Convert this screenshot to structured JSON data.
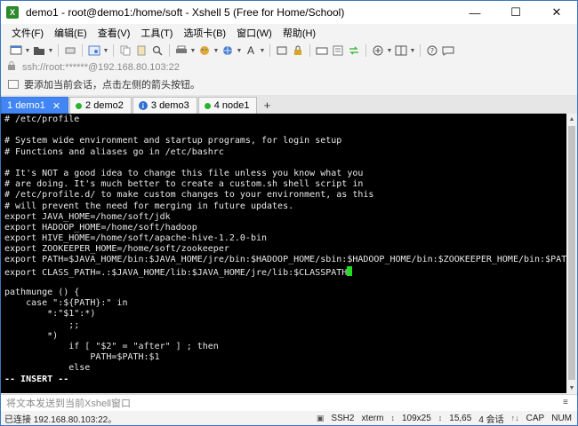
{
  "window": {
    "title": "demo1 - root@demo1:/home/soft - Xshell 5 (Free for Home/School)",
    "controls": {
      "minimize": "—",
      "maximize": "☐",
      "close": "✕"
    }
  },
  "menu": [
    {
      "label": "文件(F)"
    },
    {
      "label": "编辑(E)"
    },
    {
      "label": "查看(V)"
    },
    {
      "label": "工具(T)"
    },
    {
      "label": "选项卡(B)"
    },
    {
      "label": "窗口(W)"
    },
    {
      "label": "帮助(H)"
    }
  ],
  "address": {
    "text": "ssh://root:******@192.168.80.103:22"
  },
  "hint": {
    "text": "要添加当前会话，点击左侧的箭头按钮。"
  },
  "tabs": [
    {
      "num": "1",
      "label": "demo1",
      "active": true
    },
    {
      "num": "2",
      "label": "demo2",
      "active": false,
      "dot_color": "#2bb32b"
    },
    {
      "num": "3",
      "label": "demo3",
      "active": false
    },
    {
      "num": "4",
      "label": "node1",
      "active": false,
      "dot_color": "#2bb32b"
    }
  ],
  "tab_close": "✕",
  "tab_add": "+",
  "terminal": {
    "lines": [
      "# /etc/profile",
      "",
      "# System wide environment and startup programs, for login setup",
      "# Functions and aliases go in /etc/bashrc",
      "",
      "# It's NOT a good idea to change this file unless you know what you",
      "# are doing. It's much better to create a custom.sh shell script in",
      "# /etc/profile.d/ to make custom changes to your environment, as this",
      "# will prevent the need for merging in future updates.",
      "export JAVA_HOME=/home/soft/jdk",
      "export HADOOP_HOME=/home/soft/hadoop",
      "export HIVE_HOME=/home/soft/apache-hive-1.2.0-bin",
      "export ZOOKEEPER_HOME=/home/soft/zookeeper",
      "export PATH=$JAVA_HOME/bin:$JAVA_HOME/jre/bin:$HADOOP_HOME/sbin:$HADOOP_HOME/bin:$ZOOKEEPER_HOME/bin:$PATH",
      "export CLASS_PATH=.:$JAVA_HOME/lib:$JAVA_HOME/jre/lib:$CLASSPATH",
      "",
      "pathmunge () {",
      "    case \":${PATH}:\" in",
      "        *:\"$1\":*)",
      "            ;;",
      "        *)",
      "            if [ \"$2\" = \"after\" ] ; then",
      "                PATH=$PATH:$1",
      "            else"
    ],
    "cursor_line": 14,
    "mode": "-- INSERT --"
  },
  "input_bar": {
    "placeholder": "将文本发送到当前Xshell窗口"
  },
  "status": {
    "left": "已连接 192.168.80.103:22。",
    "protocol": "SSH2",
    "term": "xterm",
    "size": "109x25",
    "cursor_pos": "15,65",
    "sessions": "4 会话",
    "caps": "CAP",
    "num": "NUM"
  }
}
